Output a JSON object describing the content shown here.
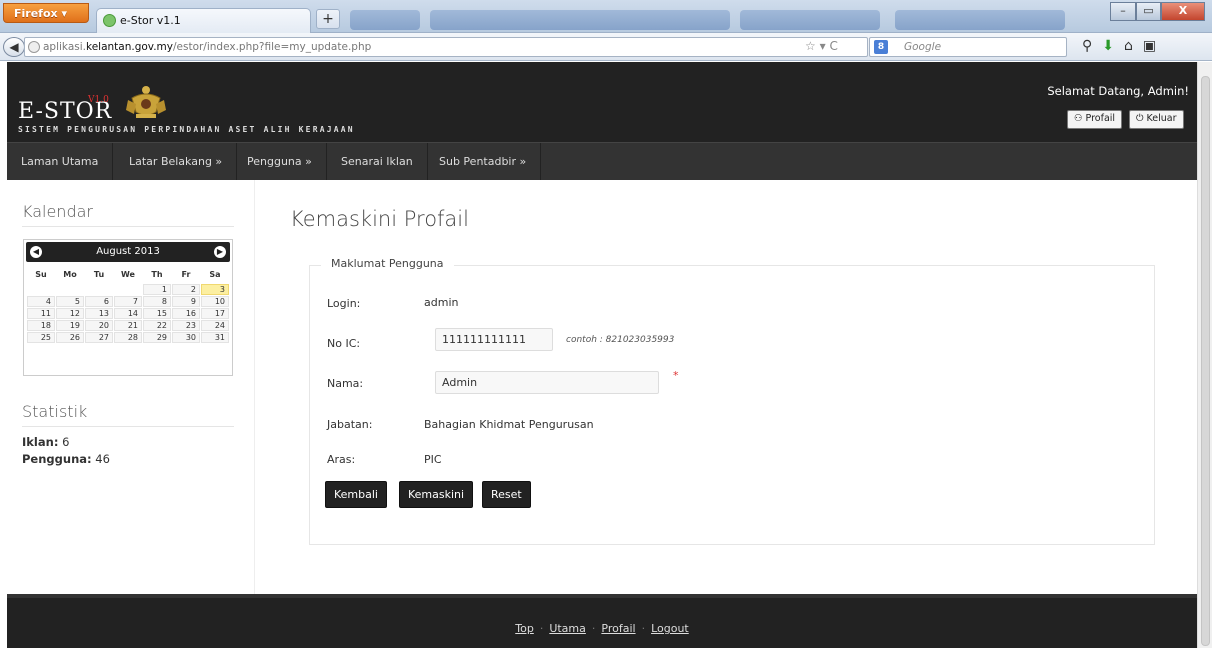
{
  "browser": {
    "menu_label": "Firefox ▾",
    "tab_title": "e-Stor v1.1",
    "new_tab": "+",
    "url_prefix": "aplikasi.",
    "url_domain": "kelantan.gov.my",
    "url_path": "/estor/index.php?file=my_update.php",
    "search_placeholder": "Google",
    "window_buttons": [
      "–",
      "▭",
      "X"
    ]
  },
  "header": {
    "logo": "E-STOR",
    "version": "V1.0",
    "tagline": "SISTEM PENGURUSAN PERPINDAHAN ASET ALIH KERAJAAN",
    "welcome": "Selamat Datang, Admin!",
    "profile_button": "Profail",
    "logout_button": "Keluar"
  },
  "menu": {
    "items": [
      {
        "label": "Laman Utama"
      },
      {
        "label": "Latar Belakang »"
      },
      {
        "label": "Pengguna »"
      },
      {
        "label": "Senarai Iklan"
      },
      {
        "label": "Sub Pentadbir »"
      }
    ]
  },
  "sidebar": {
    "calendar_heading": "Kalendar",
    "calendar": {
      "month": "August 2013",
      "weekdays": [
        "Su",
        "Mo",
        "Tu",
        "We",
        "Th",
        "Fr",
        "Sa"
      ],
      "weeks": [
        [
          "",
          "",
          "",
          "",
          "1",
          "2",
          "3"
        ],
        [
          "4",
          "5",
          "6",
          "7",
          "8",
          "9",
          "10"
        ],
        [
          "11",
          "12",
          "13",
          "14",
          "15",
          "16",
          "17"
        ],
        [
          "18",
          "19",
          "20",
          "21",
          "22",
          "23",
          "24"
        ],
        [
          "25",
          "26",
          "27",
          "28",
          "29",
          "30",
          "31"
        ]
      ],
      "today": "3"
    },
    "stats_heading": "Statistik",
    "stats": {
      "ads_label": "Iklan:",
      "ads_value": "6",
      "users_label": "Pengguna:",
      "users_value": "46"
    }
  },
  "main": {
    "title": "Kemaskini Profail",
    "legend": "Maklumat Pengguna",
    "fields": {
      "login_label": "Login:",
      "login_value": "admin",
      "ic_label": "No IC:",
      "ic_value": "111111111111",
      "ic_hint": "contoh : 821023035993",
      "name_label": "Nama:",
      "name_value": "Admin",
      "required_mark": "*",
      "dept_label": "Jabatan:",
      "dept_value": "Bahagian Khidmat Pengurusan",
      "level_label": "Aras:",
      "level_value": "PIC"
    },
    "buttons": {
      "back": "Kembali",
      "update": "Kemaskini",
      "reset": "Reset"
    }
  },
  "footer": {
    "links": [
      "Top",
      "Utama",
      "Profail",
      "Logout"
    ],
    "separator": "·"
  }
}
